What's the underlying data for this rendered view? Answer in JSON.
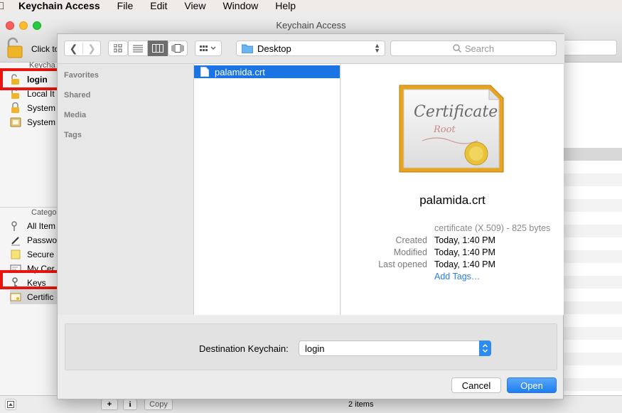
{
  "menubar": {
    "items": [
      "Keychain Access",
      "File",
      "Edit",
      "View",
      "Window",
      "Help"
    ]
  },
  "window": {
    "title": "Keychain Access",
    "click_to_lock": "Click to",
    "keychains_header": "Keycha",
    "keychains": [
      {
        "label": "login",
        "icon": "unlocked-padlock-icon"
      },
      {
        "label": "Local It",
        "icon": "unlocked-padlock-icon"
      },
      {
        "label": "System",
        "icon": "locked-padlock-icon"
      },
      {
        "label": "System",
        "icon": "cabinet-icon"
      }
    ],
    "category_header": "Catego",
    "categories": [
      {
        "label": "All Item",
        "icon": "keys-icon"
      },
      {
        "label": "Passwo",
        "icon": "pencil-icon"
      },
      {
        "label": "Secure",
        "icon": "note-icon"
      },
      {
        "label": "My Cer",
        "icon": "certificate-icon"
      },
      {
        "label": "Keys",
        "icon": "key-icon"
      },
      {
        "label": "Certific",
        "icon": "certificate-icon"
      }
    ],
    "bottom": {
      "add": "+",
      "info": "i",
      "copy": "Copy",
      "status": "2 items"
    }
  },
  "dialog": {
    "path": "Desktop",
    "search_placeholder": "Search",
    "sidebar_headers": [
      "Favorites",
      "Shared",
      "Media",
      "Tags"
    ],
    "file": "palamida.crt",
    "preview": {
      "name": "palamida.crt",
      "cert_text_1": "Certificate",
      "cert_text_2": "Root",
      "kind": "certificate (X.509) - 825 bytes",
      "rows": [
        {
          "label": "Created",
          "value": "Today, 1:40 PM"
        },
        {
          "label": "Modified",
          "value": "Today, 1:40 PM"
        },
        {
          "label": "Last opened",
          "value": "Today, 1:40 PM"
        }
      ],
      "add_tags": "Add Tags…"
    },
    "destination_label": "Destination Keychain:",
    "destination_value": "login",
    "cancel": "Cancel",
    "open": "Open"
  }
}
